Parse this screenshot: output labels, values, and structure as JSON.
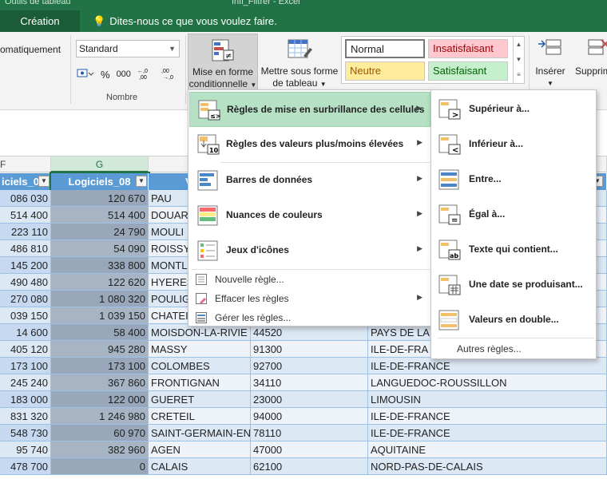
{
  "window": {
    "context_label": "Outils de tableau",
    "title": "Infi_Filtrer - Excel",
    "context_tab": "Création",
    "tell_me": "Dites-nous ce que vous voulez faire."
  },
  "ribbon": {
    "wrap_text_fragment": "omatiquement",
    "number_format": "Standard",
    "number_group_label": "Nombre",
    "currency_symbol": "€",
    "percent_symbol": "%",
    "thousands_symbol": "000",
    "inc_decimal": ",00→,0",
    "dec_decimal": ",0→,00",
    "conditional_format_label_1": "Mise en forme",
    "conditional_format_label_2": "conditionnelle",
    "format_table_label_1": "Mettre sous forme",
    "format_table_label_2": "de tableau",
    "styles": {
      "normal": "Normal",
      "bad": "Insatisfaisant",
      "neutral": "Neutre",
      "good": "Satisfaisant"
    },
    "insert_label": "Insérer",
    "delete_label": "Supprime"
  },
  "columns": {
    "f": "F",
    "g": "G"
  },
  "table": {
    "headers": {
      "col_f": "iciels_08",
      "col_g": "Logiciels_08",
      "col_h": "V"
    },
    "rows": [
      {
        "f": "086 030",
        "g": "120 670",
        "h": "PAU",
        "i": "",
        "j": ""
      },
      {
        "f": "514 400",
        "g": "514 400",
        "h": "DOUAR",
        "i": "",
        "j": ""
      },
      {
        "f": "223 110",
        "g": "24 790",
        "h": "MOULI",
        "i": "",
        "j": ""
      },
      {
        "f": "486 810",
        "g": "54 090",
        "h": "ROISSY",
        "i": "",
        "j": ""
      },
      {
        "f": "145 200",
        "g": "338 800",
        "h": "MONTL",
        "i": "",
        "j": ""
      },
      {
        "f": "490 480",
        "g": "122 620",
        "h": "HYERES",
        "i": "",
        "j": ""
      },
      {
        "f": "270 080",
        "g": "1 080 320",
        "h": "POULIG",
        "i": "",
        "j": ""
      },
      {
        "f": "039 150",
        "g": "1 039 150",
        "h": "CHATEI",
        "i": "",
        "j": ""
      },
      {
        "f": "14 600",
        "g": "58 400",
        "h": "MOISDON-LA-RIVIE",
        "i": "44520",
        "j": "PAYS DE LA"
      },
      {
        "f": "405 120",
        "g": "945 280",
        "h": "MASSY",
        "i": "91300",
        "j": "ILE-DE-FRA"
      },
      {
        "f": "173 100",
        "g": "173 100",
        "h": "COLOMBES",
        "i": "92700",
        "j": "ILE-DE-FRANCE"
      },
      {
        "f": "245 240",
        "g": "367 860",
        "h": "FRONTIGNAN",
        "i": "34110",
        "j": "LANGUEDOC-ROUSSILLON"
      },
      {
        "f": "183 000",
        "g": "122 000",
        "h": "GUERET",
        "i": "23000",
        "j": "LIMOUSIN"
      },
      {
        "f": "831 320",
        "g": "1 246 980",
        "h": "CRETEIL",
        "i": "94000",
        "j": "ILE-DE-FRANCE"
      },
      {
        "f": "548 730",
        "g": "60 970",
        "h": "SAINT-GERMAIN-EN",
        "i": "78110",
        "j": "ILE-DE-FRANCE"
      },
      {
        "f": "95 740",
        "g": "382 960",
        "h": "AGEN",
        "i": "47000",
        "j": "AQUITAINE"
      },
      {
        "f": "478 700",
        "g": "0",
        "h": "CALAIS",
        "i": "62100",
        "j": "NORD-PAS-DE-CALAIS"
      }
    ]
  },
  "cf_menu": {
    "items": [
      {
        "label": "Règles de mise en surbrillance des cellules"
      },
      {
        "label": "Règles des valeurs plus/moins élevées"
      },
      {
        "label": "Barres de données"
      },
      {
        "label": "Nuances de couleurs"
      },
      {
        "label": "Jeux d'icônes"
      }
    ],
    "actions": [
      {
        "label": "Nouvelle règle..."
      },
      {
        "label": "Effacer les règles"
      },
      {
        "label": "Gérer les règles..."
      }
    ]
  },
  "sub_menu": {
    "items": [
      {
        "label": "Supérieur à..."
      },
      {
        "label": "Inférieur à..."
      },
      {
        "label": "Entre..."
      },
      {
        "label": "Égal à..."
      },
      {
        "label": "Texte qui contient..."
      },
      {
        "label": "Une date se produisant..."
      },
      {
        "label": "Valeurs en double..."
      }
    ],
    "more": "Autres règles..."
  },
  "colors": {
    "excel_green": "#217346",
    "header_blue": "#5b9bd5",
    "menu_highlight": "#b7e1c5"
  }
}
